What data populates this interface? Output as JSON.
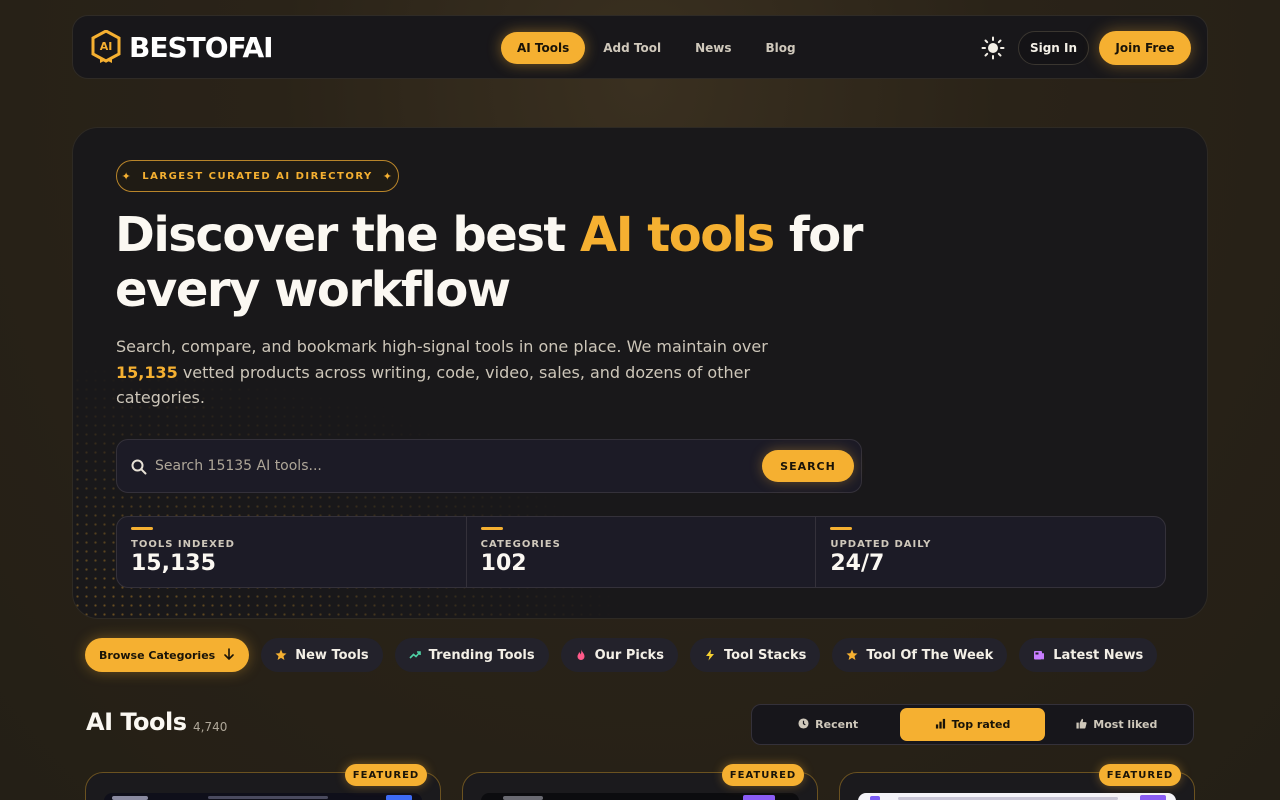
{
  "nav": {
    "logo_text": "BESTOFAI",
    "logo_badge": "AI",
    "links": [
      {
        "label": "AI Tools",
        "active": true
      },
      {
        "label": "Add Tool",
        "active": false
      },
      {
        "label": "News",
        "active": false
      },
      {
        "label": "Blog",
        "active": false
      }
    ],
    "sign_in": "Sign In",
    "join": "Join Free",
    "theme_icon": "sun-icon"
  },
  "hero": {
    "badge": "LARGEST CURATED AI DIRECTORY",
    "title_pre": "Discover the best ",
    "title_accent": "AI tools",
    "title_post": " for every workflow",
    "sub_pre": "Search, compare, and bookmark high-signal tools in one place. We maintain over ",
    "sub_num": "15,135",
    "sub_post": " vetted products across writing, code, video, sales, and dozens of other categories.",
    "search_placeholder": "Search 15135 AI tools...",
    "search_button": "SEARCH",
    "stats": [
      {
        "label": "TOOLS INDEXED",
        "value": "15,135"
      },
      {
        "label": "CATEGORIES",
        "value": "102"
      },
      {
        "label": "UPDATED DAILY",
        "value": "24/7"
      }
    ]
  },
  "filters": {
    "browse": "Browse Categories",
    "pills": [
      {
        "label": "New Tools",
        "icon": "star-icon",
        "color": "#f5b031"
      },
      {
        "label": "Trending Tools",
        "icon": "trending-icon",
        "color": "#4fd1a5"
      },
      {
        "label": "Our Picks",
        "icon": "fire-icon",
        "color": "#ff5a8a"
      },
      {
        "label": "Tool Stacks",
        "icon": "bolt-icon",
        "color": "#f5d031"
      },
      {
        "label": "Tool Of The Week",
        "icon": "star-icon",
        "color": "#f5b031"
      },
      {
        "label": "Latest News",
        "icon": "news-icon",
        "color": "#c77dff"
      }
    ]
  },
  "section": {
    "title": "AI Tools",
    "count": "4,740",
    "sort": [
      {
        "label": "Recent",
        "icon": "clock-icon",
        "active": false
      },
      {
        "label": "Top rated",
        "icon": "bar-chart-icon",
        "active": true
      },
      {
        "label": "Most liked",
        "icon": "thumbs-up-icon",
        "active": false
      }
    ]
  },
  "cards": [
    {
      "badge": "FEATURED"
    },
    {
      "badge": "FEATURED"
    },
    {
      "badge": "FEATURED"
    }
  ],
  "colors": {
    "accent": "#f5b031",
    "background": "#241f16",
    "panel": "#19181a"
  }
}
